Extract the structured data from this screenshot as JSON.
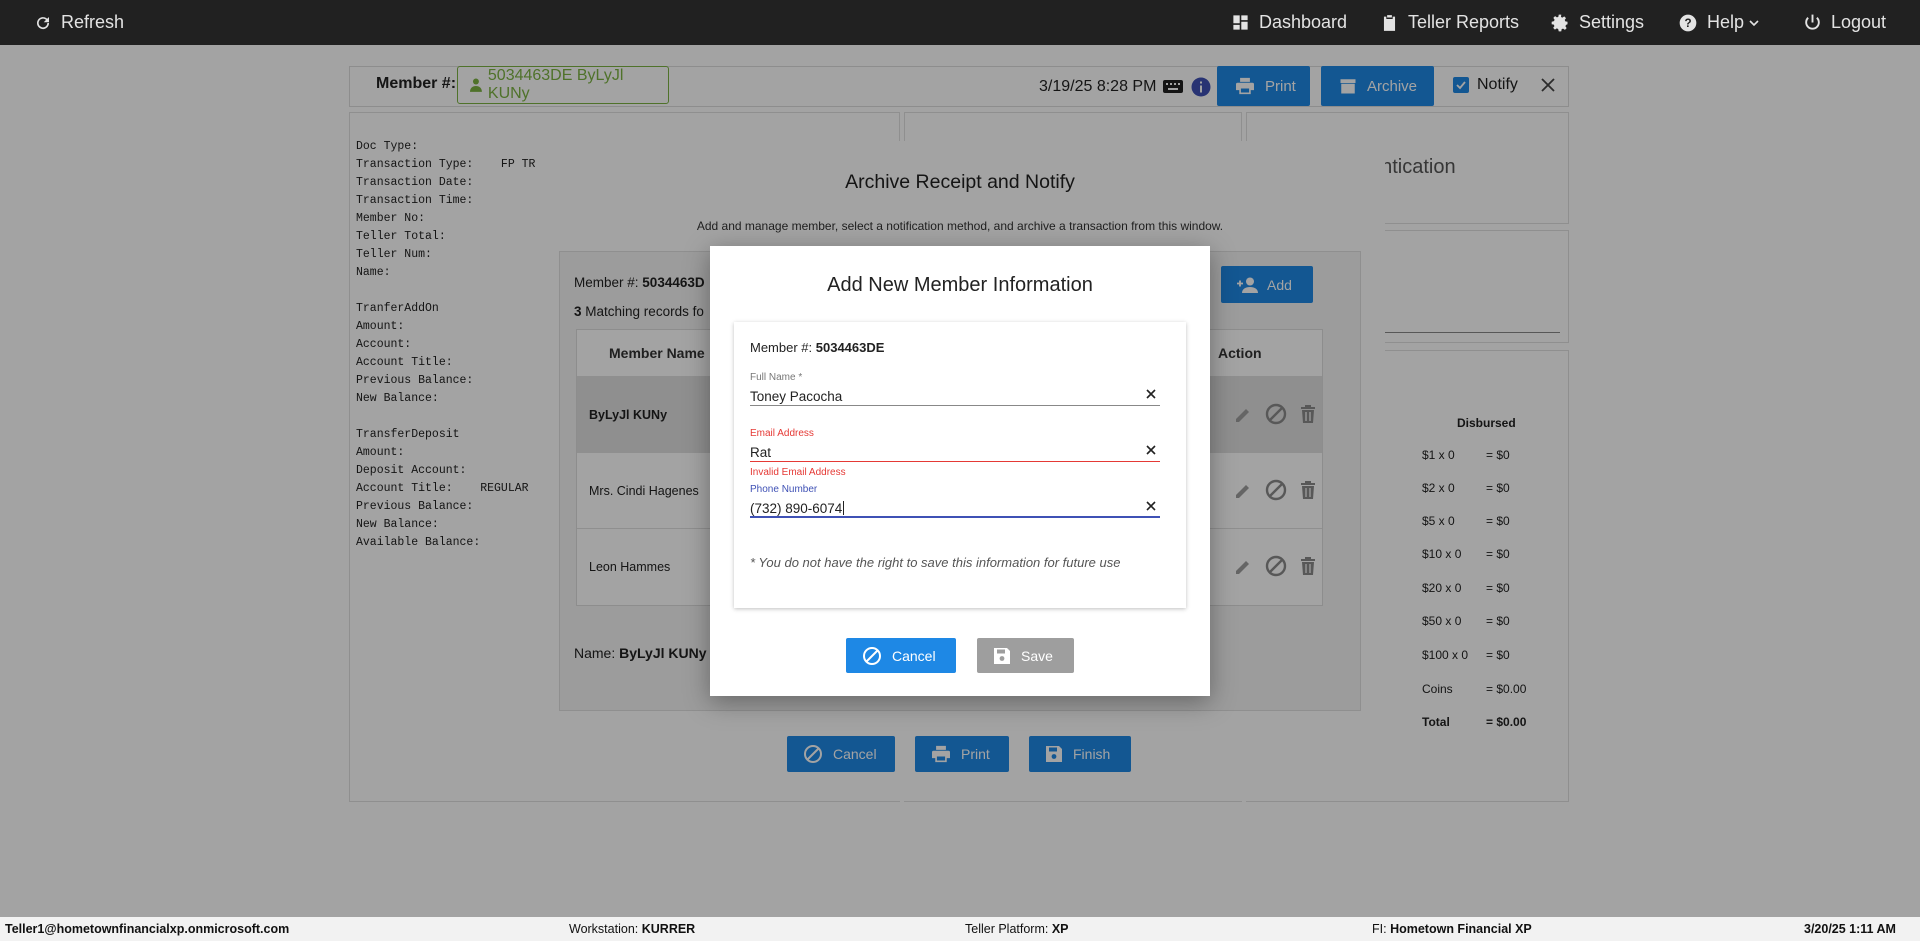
{
  "topnav": {
    "refresh": "Refresh",
    "dashboard": "Dashboard",
    "teller_reports": "Teller Reports",
    "settings": "Settings",
    "help": "Help",
    "logout": "Logout"
  },
  "header": {
    "member_label": "Member #:",
    "member_chip": "5034463DE ByLyJl KUNy",
    "datetime": "3/19/25 8:28 PM",
    "print": "Print",
    "archive": "Archive",
    "notify": "Notify"
  },
  "receipt": {
    "text": "Doc Type:\nTransaction Type:    FP TRA\nTransaction Date:\nTransaction Time:\nMember No:                 *\nTeller Total:\nTeller Num:\nName:                      Ja\n\nTranferAddOn\nAmount:\nAccount:                   1\nAccount Title:\nPrevious Balance:\nNew Balance:\n\nTransferDeposit\nAmount:\nDeposit Account:\nAccount Title:    REGULAR\nPrevious Balance:          *\nNew Balance:               *\nAvailable Balance:"
  },
  "right_panel": {
    "auth_text": "entication",
    "disbursed_header": "Disbursed",
    "rows": [
      {
        "denom": "$1 x 0",
        "amount": "= $0"
      },
      {
        "denom": "$2 x 0",
        "amount": "= $0"
      },
      {
        "denom": "$5 x 0",
        "amount": "= $0"
      },
      {
        "denom": "$10 x 0",
        "amount": "= $0"
      },
      {
        "denom": "$20 x 0",
        "amount": "= $0"
      },
      {
        "denom": "$50 x 0",
        "amount": "= $0"
      },
      {
        "denom": "$100 x 0",
        "amount": "= $0"
      },
      {
        "denom": "Coins",
        "amount": "= $0.00"
      },
      {
        "denom": "Total",
        "amount": "= $0.00"
      }
    ]
  },
  "archive_modal": {
    "title": "Archive Receipt and Notify",
    "subtitle": "Add and manage member, select a notification method, and archive a transaction from this window.",
    "member_label": "Member #:",
    "member_value": "5034463D",
    "matching_count": "3",
    "matching_text": "Matching records fo",
    "add": "Add",
    "col_member_name": "Member Name",
    "col_action": "Action",
    "rows": [
      {
        "name": "ByLyJl KUNy"
      },
      {
        "name": "Mrs. Cindi Hagenes"
      },
      {
        "name": "Leon Hammes"
      }
    ],
    "name_label": "Name:",
    "name_value": "ByLyJl KUNy",
    "cancel": "Cancel",
    "print": "Print",
    "finish": "Finish"
  },
  "add_member_dialog": {
    "title": "Add New Member Information",
    "member_label": "Member #:",
    "member_value": "5034463DE",
    "full_name_label": "Full Name *",
    "full_name_value": "Toney Pacocha",
    "email_label": "Email Address",
    "email_value": "Rat",
    "email_error": "Invalid Email Address",
    "phone_label": "Phone Number",
    "phone_value": "(732) 890-6074",
    "notice": "* You do not have the right to save this information for future use",
    "cancel": "Cancel",
    "save": "Save"
  },
  "statusbar": {
    "user": "Teller1@hometownfinancialxp.onmicrosoft.com",
    "workstation_label": "Workstation:",
    "workstation_value": "KURRER",
    "platform_label": "Teller Platform:",
    "platform_value": "XP",
    "fi_label": "FI:",
    "fi_value": "Hometown Financial XP",
    "datetime": "3/20/25 1:11 AM"
  },
  "colors": {
    "primary": "#1e88e5",
    "error": "#e53935",
    "focus": "#3f51b5",
    "member_chip": "#7cb342",
    "nav_bg": "#212121",
    "disabled": "#9e9e9e"
  }
}
